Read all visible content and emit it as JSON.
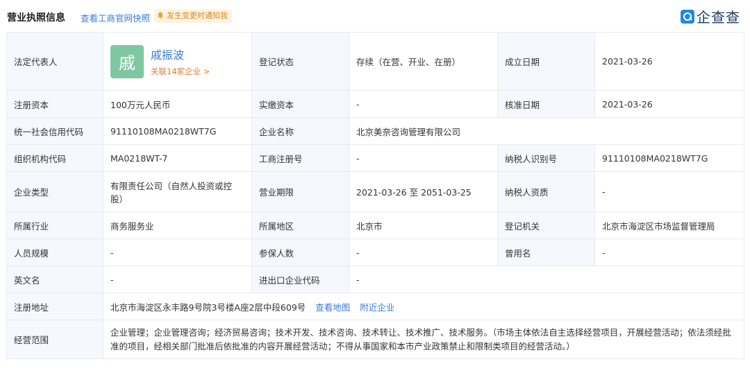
{
  "header": {
    "title": "营业执照信息",
    "snapshot_link": "查看工商官网快照",
    "notify_label": "发生变更时通知我",
    "logo_text": "企查查"
  },
  "rows": {
    "legal_rep": {
      "label": "法定代表人",
      "avatar_char": "戚",
      "name": "戚振波",
      "related": "关联14家企业 >",
      "reg_status_label": "登记状态",
      "reg_status": "存续（在营、开业、在册）",
      "est_date_label": "成立日期",
      "est_date": "2021-03-26"
    },
    "capital": {
      "label": "注册资本",
      "value": "100万元人民币",
      "paid_label": "实缴资本",
      "paid": "-",
      "approve_label": "核准日期",
      "approve": "2021-03-26"
    },
    "credit": {
      "label": "统一社会信用代码",
      "value": "91110108MA0218WT7G",
      "name_label": "企业名称",
      "name": "北京美奈咨询管理有限公司"
    },
    "org": {
      "label": "组织机构代码",
      "value": "MA0218WT-7",
      "reg_no_label": "工商注册号",
      "reg_no": "-",
      "tax_label": "纳税人识别号",
      "tax": "91110108MA0218WT7G"
    },
    "type": {
      "label": "企业类型",
      "value": "有限责任公司（自然人投资或控股）",
      "term_label": "营业期限",
      "term": "2021-03-26 至 2051-03-25",
      "tax_q_label": "纳税人资质",
      "tax_q": "-"
    },
    "industry": {
      "label": "所属行业",
      "value": "商务服务业",
      "region_label": "所属地区",
      "region": "北京市",
      "authority_label": "登记机关",
      "authority": "北京市海淀区市场监督管理局"
    },
    "staff": {
      "label": "人员规模",
      "value": "-",
      "insured_label": "参保人数",
      "insured": "-",
      "former_label": "曾用名",
      "former": "-"
    },
    "english": {
      "label": "英文名",
      "value": "-",
      "ie_label": "进出口企业代码",
      "ie": "-"
    },
    "address": {
      "label": "注册地址",
      "value": "北京市海淀区永丰路9号院3号楼A座2层中段609号",
      "map_link": "查看地图",
      "nearby_link": "附近企业"
    },
    "scope": {
      "label": "经营范围",
      "value": "企业管理；企业管理咨询；经济贸易咨询；技术开发、技术咨询、技术转让、技术推广、技术服务。（市场主体依法自主选择经营项目，开展经营活动；依法须经批准的项目，经相关部门批准后依批准的内容开展经营活动；不得从事国家和本市产业政策禁止和限制类项目的经营活动。）"
    }
  }
}
